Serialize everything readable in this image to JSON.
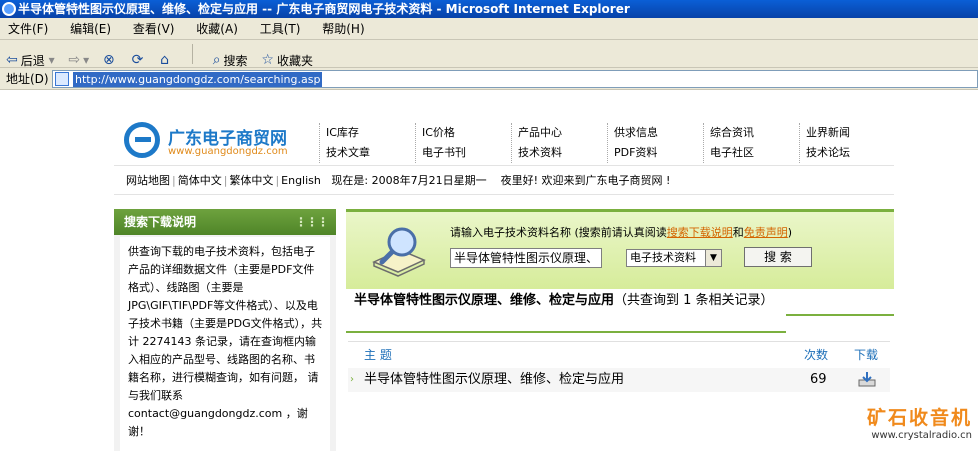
{
  "window": {
    "title": "半导体管特性图示仪原理、维修、检定与应用 -- 广东电子商贸网电子技术资料 - Microsoft Internet Explorer"
  },
  "menubar": {
    "items": [
      "文件(F)",
      "编辑(E)",
      "查看(V)",
      "收藏(A)",
      "工具(T)",
      "帮助(H)"
    ]
  },
  "toolbar": {
    "back_label": "后退",
    "search_label": "搜索",
    "favorites_label": "收藏夹"
  },
  "addressbar": {
    "label": "地址(D)",
    "url": "http://www.guangdongdz.com/searching.asp"
  },
  "site": {
    "logo_name": "广东电子商贸网",
    "logo_domain": "www.guangdongdz.com",
    "nav_columns": [
      [
        "IC库存",
        "技术文章"
      ],
      [
        "IC价格",
        "电子书刊"
      ],
      [
        "产品中心",
        "技术资料"
      ],
      [
        "供求信息",
        "PDF资料"
      ],
      [
        "综合资讯",
        "电子社区"
      ],
      [
        "业界新闻",
        "技术论坛"
      ]
    ],
    "infobar": {
      "links": [
        "网站地图",
        "简体中文",
        "繁体中文",
        "English"
      ],
      "date_text": "现在是: 2008年7月21日星期一",
      "greeting": "夜里好! 欢迎来到广东电子商贸网 !"
    }
  },
  "sidebar": {
    "title": "搜索下载说明",
    "grip": "⋮⋮⋮",
    "body": "供查询下载的电子技术资料，包括电子产品的详细数据文件（主要是PDF文件格式）、线路图（主要是JPG\\GIF\\TIF\\PDF等文件格式）、以及电子技术书籍（主要是PDG文件格式），共计 2274143 条记录，请在查询框内输入相应的产品型号、线路图的名称、书籍名称，进行模糊查询，如有问题， 请与我们联系 contact@guangdongdz.com ，谢谢！"
  },
  "search": {
    "prompt_prefix": "请输入电子技术资料名称 (搜索前请认真阅读",
    "link_instructions": "搜索下载说明",
    "and": "和",
    "link_disclaimer": "免责声明",
    "prompt_suffix": ")",
    "keyword_value": "半导体管特性图示仪原理、",
    "category_value": "电子技术资料",
    "button_label": "搜 索"
  },
  "results": {
    "title": "半导体管特性图示仪原理、维修、检定与应用",
    "count_text": "（共查询到 1 条相关记录）",
    "headers": {
      "subject": "主 题",
      "times": "次数",
      "download": "下载"
    },
    "rows": [
      {
        "subject": "半导体管特性图示仪原理、维修、检定与应用",
        "times": "69"
      }
    ]
  },
  "watermark": {
    "line1": "矿石收音机",
    "line2": "www.crystalradio.cn"
  }
}
